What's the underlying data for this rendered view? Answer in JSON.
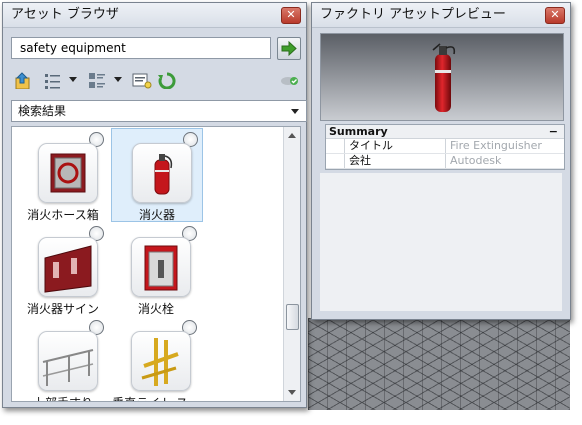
{
  "browser": {
    "title": "アセット ブラウザ",
    "close_icon": "close-icon",
    "search": {
      "value": "safety equipment",
      "go_icon": "arrow-right-icon"
    },
    "toolbar_icons": [
      "import-icon",
      "list-view-icon",
      "thumbnail-view-icon",
      "properties-icon",
      "refresh-icon",
      "cloud-sync-icon"
    ],
    "filter": {
      "selected": "検索結果"
    },
    "assets": [
      {
        "label": "消火ホース箱",
        "icon": "fire-hose-cabinet-icon"
      },
      {
        "label": "消火器",
        "icon": "fire-extinguisher-icon",
        "selected": true
      },
      {
        "label": "消火器サイン",
        "icon": "extinguisher-sign-icon"
      },
      {
        "label": "消火栓",
        "icon": "fire-hydrant-cabinet-icon"
      },
      {
        "label": "上部手すり",
        "icon": "top-railing-icon"
      },
      {
        "label": "垂直ライト ス…",
        "icon": "vertical-light-stand-icon"
      }
    ]
  },
  "preview": {
    "title": "ファクトリ アセットプレビュー",
    "close_icon": "close-icon",
    "image_icon": "fire-extinguisher-icon",
    "summary": {
      "heading": "Summary",
      "collapse": "−",
      "rows": [
        {
          "key": "タイトル",
          "value": "Fire Extinguisher"
        },
        {
          "key": "会社",
          "value": "Autodesk"
        }
      ]
    }
  }
}
